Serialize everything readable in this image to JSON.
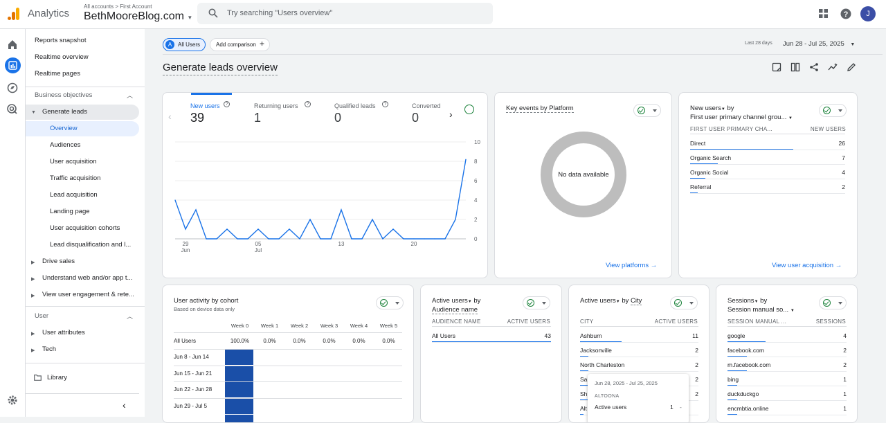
{
  "header": {
    "app_name": "Analytics",
    "breadcrumb": "All accounts > First Account",
    "account": "BethMooreBlog.com",
    "search_placeholder": "Try searching \"Users overview\"",
    "avatar_letter": "J",
    "icons": [
      "apps-grid-icon",
      "help-icon"
    ]
  },
  "rail_icons": [
    "home-icon",
    "reports-icon",
    "explore-icon",
    "advertising-icon",
    "settings-icon"
  ],
  "nav": {
    "top_items": [
      "Reports snapshot",
      "Realtime overview",
      "Realtime pages"
    ],
    "section_business": "Business objectives",
    "generate_leads": "Generate leads",
    "leads_children": [
      "Overview",
      "Audiences",
      "User acquisition",
      "Traffic acquisition",
      "Lead acquisition",
      "Landing page",
      "User acquisition cohorts",
      "Lead disqualification and l..."
    ],
    "groups": [
      "Drive sales",
      "Understand web and/or app t...",
      "View user engagement & rete..."
    ],
    "section_user": "User",
    "user_groups": [
      "User attributes",
      "Tech"
    ],
    "library": "Library"
  },
  "toolbar": {
    "segment_badge": "A",
    "segment": "All Users",
    "add_comparison": "Add comparison",
    "date_prefix": "Last 28 days",
    "date_range": "Jun 28 - Jul 25, 2025"
  },
  "page_title": "Generate leads overview",
  "metrics": [
    {
      "label": "New users",
      "value": "39"
    },
    {
      "label": "Returning users",
      "value": "1"
    },
    {
      "label": "Qualified leads",
      "value": "0"
    },
    {
      "label": "Converted",
      "value": "0"
    }
  ],
  "chart_data": {
    "type": "line",
    "x_ticks": [
      "29\nJun",
      "05\nJul",
      "13",
      "20"
    ],
    "y_ticks": [
      0,
      2,
      4,
      6,
      8,
      10
    ],
    "ylim": [
      0,
      10
    ],
    "series": [
      {
        "values": [
          4,
          1,
          3,
          0,
          0,
          1,
          0,
          0,
          1,
          0,
          0,
          1,
          0,
          2,
          0,
          0,
          3,
          0,
          0,
          2,
          0,
          1,
          0,
          0,
          0,
          0,
          0,
          2,
          8.2
        ]
      }
    ]
  },
  "platform_card": {
    "title": "Key events by Platform",
    "empty": "No data available",
    "link": "View platforms"
  },
  "channel_card": {
    "title1": "New users",
    "title2": "by",
    "title3": "First user primary channel grou...",
    "col1": "FIRST USER PRIMARY CHA...",
    "col2": "NEW USERS",
    "rows": [
      {
        "name": "Direct",
        "value": "26",
        "frac": 0.667
      },
      {
        "name": "Organic Search",
        "value": "7",
        "frac": 0.18
      },
      {
        "name": "Organic Social",
        "value": "4",
        "frac": 0.1
      },
      {
        "name": "Referral",
        "value": "2",
        "frac": 0.05
      }
    ],
    "link": "View user acquisition"
  },
  "cohort_card": {
    "title": "User activity by cohort",
    "subtitle": "Based on device data only",
    "weeks": [
      "Week 0",
      "Week 1",
      "Week 2",
      "Week 3",
      "Week 4",
      "Week 5"
    ],
    "all_label": "All Users",
    "all_values": [
      "100.0%",
      "0.0%",
      "0.0%",
      "0.0%",
      "0.0%",
      "0.0%"
    ],
    "rows": [
      "Jun 8 - Jun 14",
      "Jun 15 - Jun 21",
      "Jun 22 - Jun 28",
      "Jun 29 - Jul 5"
    ]
  },
  "audience_card": {
    "title1": "Active users",
    "title2": "by",
    "title3": "Audience name",
    "col1": "AUDIENCE NAME",
    "col2": "ACTIVE USERS",
    "rows": [
      {
        "name": "All Users",
        "value": "43",
        "frac": 1.0
      }
    ]
  },
  "city_card": {
    "title1": "Active users",
    "title2": "by",
    "title3": "City",
    "col1": "CITY",
    "col2": "ACTIVE USERS",
    "rows": [
      {
        "name": "Ashburn",
        "value": "11",
        "frac": 0.35
      },
      {
        "name": "Jacksonville",
        "value": "2",
        "frac": 0.07
      },
      {
        "name": "North Charleston",
        "value": "2",
        "frac": 0.07
      },
      {
        "name": "Sa",
        "value": "2",
        "frac": 0.07
      },
      {
        "name": "Sh",
        "value": "2",
        "frac": 0.07
      },
      {
        "name": "Alt",
        "value": "",
        "frac": 0.03
      }
    ],
    "tooltip": {
      "date": "Jun 28, 2025 - Jul 25, 2025",
      "city": "ALTOONA",
      "metric": "Active users",
      "value": "1",
      "delta": "-"
    }
  },
  "session_card": {
    "title1": "Sessions",
    "title2": "by",
    "title3": "Session manual so...",
    "col1": "SESSION MANUAL ...",
    "col2": "SESSIONS",
    "rows": [
      {
        "name": "google",
        "value": "4",
        "frac": 0.32
      },
      {
        "name": "facebook.com",
        "value": "2",
        "frac": 0.16
      },
      {
        "name": "m.facebook.com",
        "value": "2",
        "frac": 0.16
      },
      {
        "name": "bing",
        "value": "1",
        "frac": 0.08
      },
      {
        "name": "duckduckgo",
        "value": "1",
        "frac": 0.08
      },
      {
        "name": "encmbtia.online",
        "value": "1",
        "frac": 0.08
      }
    ]
  }
}
